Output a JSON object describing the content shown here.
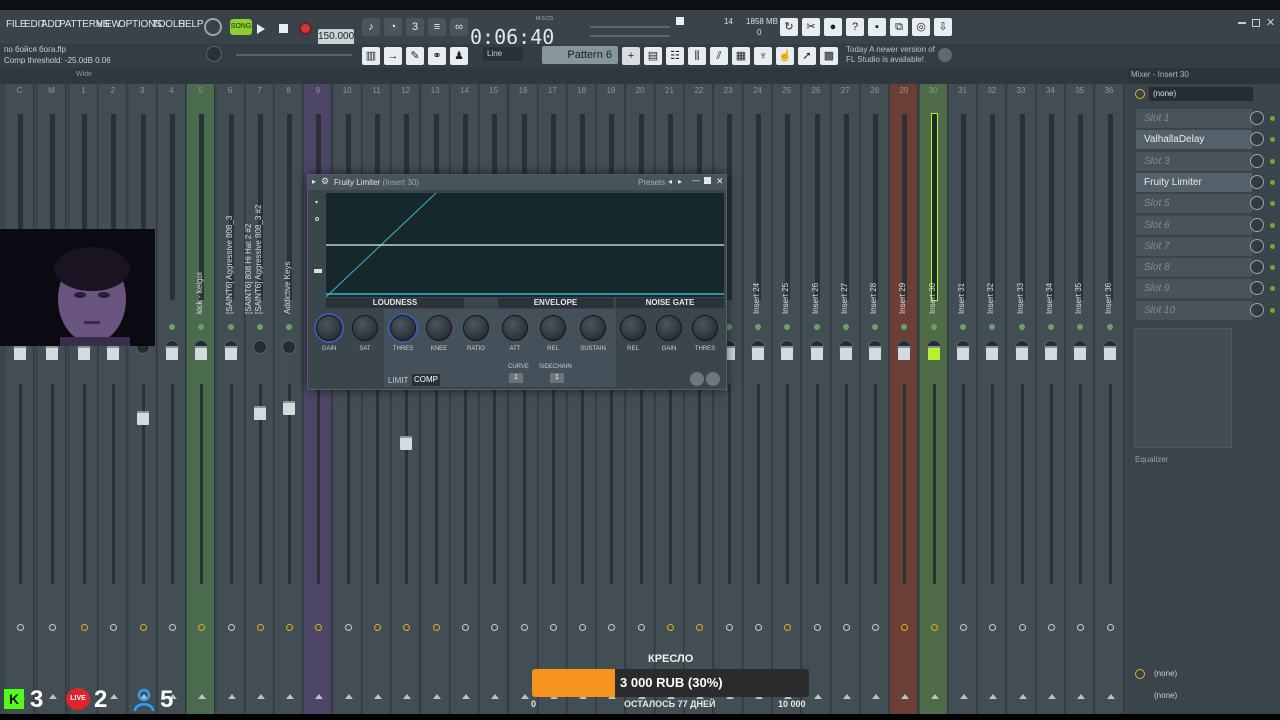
{
  "menu": [
    "FILE",
    "EDIT",
    "ADD",
    "PATTERNS",
    "VIEW",
    "OPTIONS",
    "TOOLS",
    "HELP"
  ],
  "toolbar": {
    "song_mode": "SONG",
    "bpm": "150.000",
    "time": "0:06:40",
    "time_unit": "M:S:CS",
    "cpu": "14",
    "memory": "1858 MB",
    "poly": "0",
    "snap": "Line",
    "pattern": "Pattern 6"
  },
  "hint": {
    "file": "по бойся бога.flp",
    "param": "Comp threshold: -25.0dB 0.06"
  },
  "news": {
    "when": "Today",
    "text": "A newer version of FL Studio is available!"
  },
  "mixer": {
    "title": "Mixer - Insert 30",
    "view": "Wide",
    "tracks": [
      {
        "num": "C",
        "name": ""
      },
      {
        "num": "M",
        "name": ""
      },
      {
        "num": "1",
        "name": ""
      },
      {
        "num": "2",
        "name": ""
      },
      {
        "num": "3",
        "name": ""
      },
      {
        "num": "4",
        "name": ""
      },
      {
        "num": "5",
        "name": "kick - keigoi"
      },
      {
        "num": "6",
        "name": "[SAINT6] Aggressive 808_3"
      },
      {
        "num": "7",
        "name": "[SAINT6] Aggressive 808_3 #2"
      },
      {
        "num": "8",
        "name": "Addictive Keys"
      },
      {
        "num": "9",
        "name": ""
      },
      {
        "num": "10",
        "name": ""
      },
      {
        "num": "11",
        "name": ""
      },
      {
        "num": "12",
        "name": ""
      },
      {
        "num": "13",
        "name": ""
      },
      {
        "num": "14",
        "name": ""
      },
      {
        "num": "15",
        "name": ""
      },
      {
        "num": "16",
        "name": ""
      },
      {
        "num": "17",
        "name": ""
      },
      {
        "num": "18",
        "name": ""
      },
      {
        "num": "19",
        "name": ""
      },
      {
        "num": "20",
        "name": ""
      },
      {
        "num": "21",
        "name": ""
      },
      {
        "num": "22",
        "name": ""
      },
      {
        "num": "23",
        "name": ""
      },
      {
        "num": "24",
        "name": "Insert 24"
      },
      {
        "num": "25",
        "name": "Insert 25"
      },
      {
        "num": "26",
        "name": "Insert 26"
      },
      {
        "num": "27",
        "name": "Insert 27"
      },
      {
        "num": "28",
        "name": "Insert 28"
      },
      {
        "num": "29",
        "name": "Insert 29"
      },
      {
        "num": "30",
        "name": "Insert 30"
      },
      {
        "num": "31",
        "name": "Insert 31"
      },
      {
        "num": "32",
        "name": "Insert 32"
      },
      {
        "num": "33",
        "name": "Insert 33"
      },
      {
        "num": "34",
        "name": "Insert 34"
      },
      {
        "num": "35",
        "name": "Insert 35"
      },
      {
        "num": "36",
        "name": "Insert 36"
      }
    ],
    "extra_label": "[SAINT6] 808 Hi Hat 2 #2"
  },
  "insert": {
    "preset": "(none)",
    "slots": [
      "Slot 1",
      "ValhallaDelay",
      "Slot 3",
      "Fruity Limiter",
      "Slot 5",
      "Slot 6",
      "Slot 7",
      "Slot 8",
      "Slot 9",
      "Slot 10"
    ],
    "eq_label": "Equalizer",
    "out_a": "(none)",
    "out_b": "(none)"
  },
  "plugin": {
    "name": "Fruity Limiter",
    "insert": "(Insert 30)",
    "presets": "Presets",
    "sections": {
      "loudness": "LOUDNESS",
      "envelope": "ENVELOPE",
      "noise_gate": "NOISE GATE"
    },
    "knobs": [
      "GAIN",
      "SAT",
      "THRES",
      "KNEE",
      "RATIO",
      "ATT",
      "REL",
      "SUSTAIN",
      "REL",
      "GAIN",
      "THRES"
    ],
    "mode_limit": "LIMIT",
    "mode_comp": "COMP",
    "curve_label": "CURVE",
    "curve_value": "1",
    "sidechain_label": "SIDECHAIN",
    "sidechain_value": "1"
  },
  "donation": {
    "label": "КРЕСЛО",
    "amount": "3 000 RUB (30%)",
    "progress": 0.3,
    "min": "0",
    "remaining": "ОСТАЛОСЬ 77 ДНЕЙ",
    "max": "10 000"
  },
  "stats": {
    "kick": "3",
    "live": "2",
    "viewers": "5",
    "live_badge": "LIVE"
  },
  "colors": {
    "accent_lime": "#b8f032",
    "donate_orange": "#f5931c"
  }
}
